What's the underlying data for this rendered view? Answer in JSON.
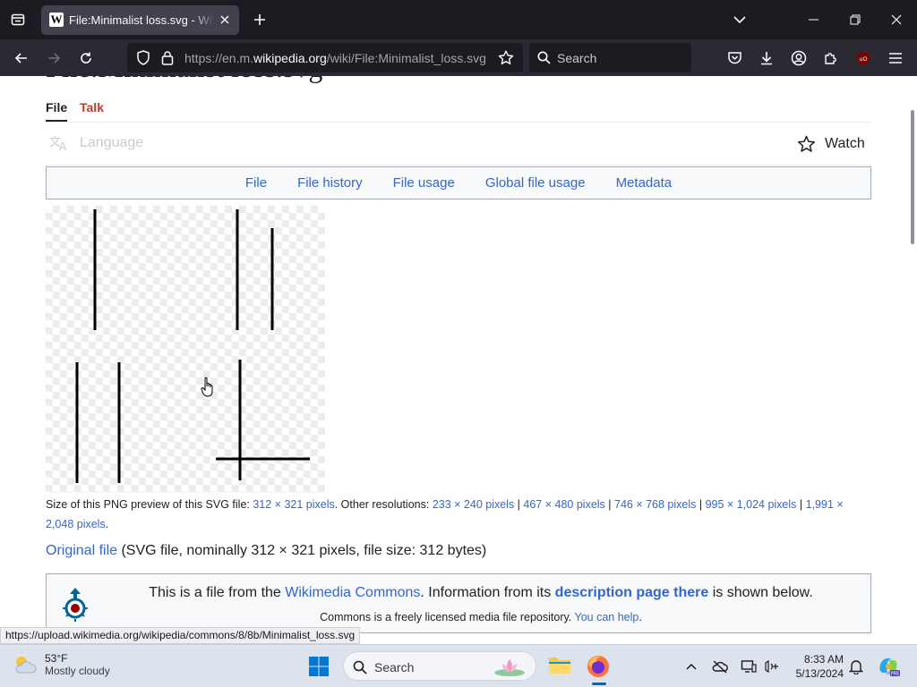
{
  "browser": {
    "tab": {
      "title": "File:Minimalist loss.svg - Wikipedia",
      "favicon": "W"
    },
    "url": {
      "prefix": "https://en.m.",
      "domain": "wikipedia.org",
      "path": "/wiki/File:Minimalist_loss.svg"
    },
    "search_placeholder": "Search",
    "status_url": "https://upload.wikimedia.org/wikipedia/commons/8/8b/Minimalist_loss.svg"
  },
  "page": {
    "title": "File:Minimalist loss.svg",
    "tabs": {
      "file": "File",
      "talk": "Talk"
    },
    "language_label": "Language",
    "watch_label": "Watch",
    "file_toc": [
      "File",
      "File history",
      "File usage",
      "Global file usage",
      "Metadata"
    ],
    "size_info": {
      "prefix": "Size of this PNG preview of this SVG file: ",
      "preview_size": "312 × 321 pixels",
      "other_label": ". Other resolutions: ",
      "resolutions": [
        "233 × 240 pixels",
        "467 × 480 pixels",
        "746 × 768 pixels",
        "995 × 1,024 pixels",
        "1,991 × 2,048 pixels"
      ],
      "separator": " | ",
      "suffix": "."
    },
    "original_file": {
      "link": "Original file",
      "details": " (SVG file, nominally 312 × 321 pixels, file size: 312 bytes)"
    },
    "commons": {
      "line1_pre": "This is a file from the ",
      "line1_link": "Wikimedia Commons",
      "line1_mid": ". Information from its ",
      "line1_bold": "description page there",
      "line1_post": " is shown below.",
      "line2_text": "Commons is a freely licensed media file repository. ",
      "line2_link": "You can help",
      "line2_post": "."
    }
  },
  "taskbar": {
    "weather_temp": "53°F",
    "weather_desc": "Mostly cloudy",
    "search_placeholder": "Search",
    "time": "8:33 AM",
    "date": "5/13/2024"
  },
  "colors": {
    "link": "#3366cc",
    "talk_red": "#bf3c2c",
    "browser_dark": "#1c1b22"
  }
}
